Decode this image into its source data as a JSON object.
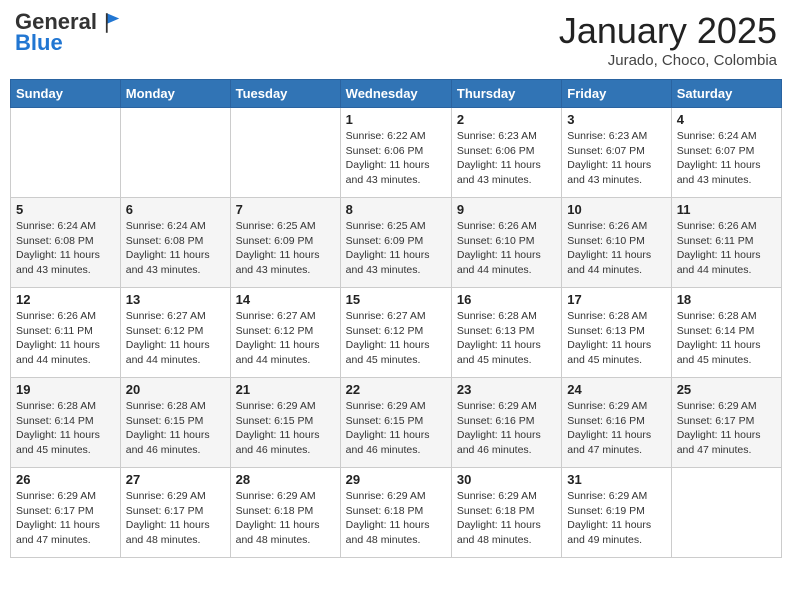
{
  "header": {
    "logo_general": "General",
    "logo_blue": "Blue",
    "month_title": "January 2025",
    "location": "Jurado, Choco, Colombia"
  },
  "weekdays": [
    "Sunday",
    "Monday",
    "Tuesday",
    "Wednesday",
    "Thursday",
    "Friday",
    "Saturday"
  ],
  "weeks": [
    [
      {
        "day": "",
        "info": ""
      },
      {
        "day": "",
        "info": ""
      },
      {
        "day": "",
        "info": ""
      },
      {
        "day": "1",
        "info": "Sunrise: 6:22 AM\nSunset: 6:06 PM\nDaylight: 11 hours and 43 minutes."
      },
      {
        "day": "2",
        "info": "Sunrise: 6:23 AM\nSunset: 6:06 PM\nDaylight: 11 hours and 43 minutes."
      },
      {
        "day": "3",
        "info": "Sunrise: 6:23 AM\nSunset: 6:07 PM\nDaylight: 11 hours and 43 minutes."
      },
      {
        "day": "4",
        "info": "Sunrise: 6:24 AM\nSunset: 6:07 PM\nDaylight: 11 hours and 43 minutes."
      }
    ],
    [
      {
        "day": "5",
        "info": "Sunrise: 6:24 AM\nSunset: 6:08 PM\nDaylight: 11 hours and 43 minutes."
      },
      {
        "day": "6",
        "info": "Sunrise: 6:24 AM\nSunset: 6:08 PM\nDaylight: 11 hours and 43 minutes."
      },
      {
        "day": "7",
        "info": "Sunrise: 6:25 AM\nSunset: 6:09 PM\nDaylight: 11 hours and 43 minutes."
      },
      {
        "day": "8",
        "info": "Sunrise: 6:25 AM\nSunset: 6:09 PM\nDaylight: 11 hours and 43 minutes."
      },
      {
        "day": "9",
        "info": "Sunrise: 6:26 AM\nSunset: 6:10 PM\nDaylight: 11 hours and 44 minutes."
      },
      {
        "day": "10",
        "info": "Sunrise: 6:26 AM\nSunset: 6:10 PM\nDaylight: 11 hours and 44 minutes."
      },
      {
        "day": "11",
        "info": "Sunrise: 6:26 AM\nSunset: 6:11 PM\nDaylight: 11 hours and 44 minutes."
      }
    ],
    [
      {
        "day": "12",
        "info": "Sunrise: 6:26 AM\nSunset: 6:11 PM\nDaylight: 11 hours and 44 minutes."
      },
      {
        "day": "13",
        "info": "Sunrise: 6:27 AM\nSunset: 6:12 PM\nDaylight: 11 hours and 44 minutes."
      },
      {
        "day": "14",
        "info": "Sunrise: 6:27 AM\nSunset: 6:12 PM\nDaylight: 11 hours and 44 minutes."
      },
      {
        "day": "15",
        "info": "Sunrise: 6:27 AM\nSunset: 6:12 PM\nDaylight: 11 hours and 45 minutes."
      },
      {
        "day": "16",
        "info": "Sunrise: 6:28 AM\nSunset: 6:13 PM\nDaylight: 11 hours and 45 minutes."
      },
      {
        "day": "17",
        "info": "Sunrise: 6:28 AM\nSunset: 6:13 PM\nDaylight: 11 hours and 45 minutes."
      },
      {
        "day": "18",
        "info": "Sunrise: 6:28 AM\nSunset: 6:14 PM\nDaylight: 11 hours and 45 minutes."
      }
    ],
    [
      {
        "day": "19",
        "info": "Sunrise: 6:28 AM\nSunset: 6:14 PM\nDaylight: 11 hours and 45 minutes."
      },
      {
        "day": "20",
        "info": "Sunrise: 6:28 AM\nSunset: 6:15 PM\nDaylight: 11 hours and 46 minutes."
      },
      {
        "day": "21",
        "info": "Sunrise: 6:29 AM\nSunset: 6:15 PM\nDaylight: 11 hours and 46 minutes."
      },
      {
        "day": "22",
        "info": "Sunrise: 6:29 AM\nSunset: 6:15 PM\nDaylight: 11 hours and 46 minutes."
      },
      {
        "day": "23",
        "info": "Sunrise: 6:29 AM\nSunset: 6:16 PM\nDaylight: 11 hours and 46 minutes."
      },
      {
        "day": "24",
        "info": "Sunrise: 6:29 AM\nSunset: 6:16 PM\nDaylight: 11 hours and 47 minutes."
      },
      {
        "day": "25",
        "info": "Sunrise: 6:29 AM\nSunset: 6:17 PM\nDaylight: 11 hours and 47 minutes."
      }
    ],
    [
      {
        "day": "26",
        "info": "Sunrise: 6:29 AM\nSunset: 6:17 PM\nDaylight: 11 hours and 47 minutes."
      },
      {
        "day": "27",
        "info": "Sunrise: 6:29 AM\nSunset: 6:17 PM\nDaylight: 11 hours and 48 minutes."
      },
      {
        "day": "28",
        "info": "Sunrise: 6:29 AM\nSunset: 6:18 PM\nDaylight: 11 hours and 48 minutes."
      },
      {
        "day": "29",
        "info": "Sunrise: 6:29 AM\nSunset: 6:18 PM\nDaylight: 11 hours and 48 minutes."
      },
      {
        "day": "30",
        "info": "Sunrise: 6:29 AM\nSunset: 6:18 PM\nDaylight: 11 hours and 48 minutes."
      },
      {
        "day": "31",
        "info": "Sunrise: 6:29 AM\nSunset: 6:19 PM\nDaylight: 11 hours and 49 minutes."
      },
      {
        "day": "",
        "info": ""
      }
    ]
  ]
}
